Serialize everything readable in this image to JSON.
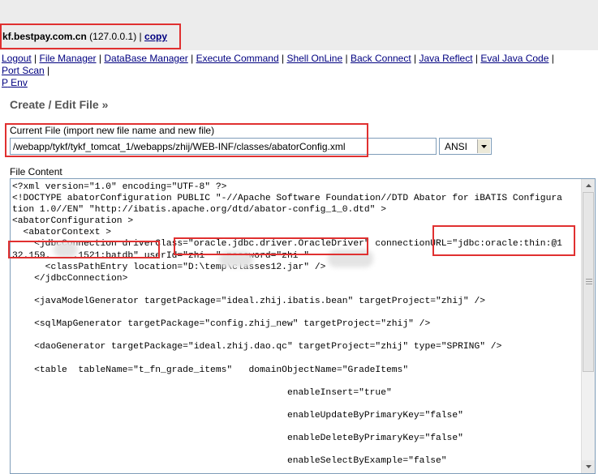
{
  "header": {
    "host": "kf.bestpay.com.cn",
    "ip": "(127.0.0.1)",
    "separator": "|",
    "copy_label": "copy"
  },
  "nav": {
    "items": [
      "Logout",
      "File Manager",
      "DataBase Manager",
      "Execute Command",
      "Shell OnLine",
      "Back Connect",
      "Java Reflect",
      "Eval Java Code",
      "Port Scan",
      "Env"
    ],
    "overflow_prefix": "P"
  },
  "page": {
    "title": "Create / Edit File »",
    "current_file_label": "Current File (import new file name and new file)",
    "current_file_value": "/webapp/tykf/tykf_tomcat_1/webapps/zhij/WEB-INF/classes/abatorConfig.xml",
    "encoding": "ANSI",
    "file_content_label": "File Content"
  },
  "editor": {
    "content": "<?xml version=\"1.0\" encoding=\"UTF-8\" ?>\n<!DOCTYPE abatorConfiguration PUBLIC \"-//Apache Software Foundation//DTD Abator for iBATIS Configura\ntion 1.0//EN\" \"http://ibatis.apache.org/dtd/abator-config_1_0.dtd\" >\n<abatorConfiguration >\n  <abatorContext >\n    <jdbcConnection driverClass=\"oracle.jdbc.driver.OracleDriver\" connectionURL=\"jdbc:oracle:thin:@1\n32.159.    .1521:batdb\" userId=\"zhi  \" password=\"zhi \"\n      <classPathEntry location=\"D:\\temp\\classes12.jar\" />\n    </jdbcConnection>\n\n    <javaModelGenerator targetPackage=\"ideal.zhij.ibatis.bean\" targetProject=\"zhij\" />\n\n    <sqlMapGenerator targetPackage=\"config.zhij_new\" targetProject=\"zhij\" />\n\n    <daoGenerator targetPackage=\"ideal.zhij.dao.qc\" targetProject=\"zhij\" type=\"SPRING\" />\n\n    <table  tableName=\"t_fn_grade_items\"   domainObjectName=\"GradeItems\"\n\n                                                  enableInsert=\"true\"\n\n                                                  enableUpdateByPrimaryKey=\"false\"\n\n                                                  enableDeleteByPrimaryKey=\"false\"\n\n                                                  enableSelectByExample=\"false\""
  },
  "colors": {
    "annotation_red": "#e03030",
    "link": "#000080",
    "header_bg": "#ececec"
  }
}
